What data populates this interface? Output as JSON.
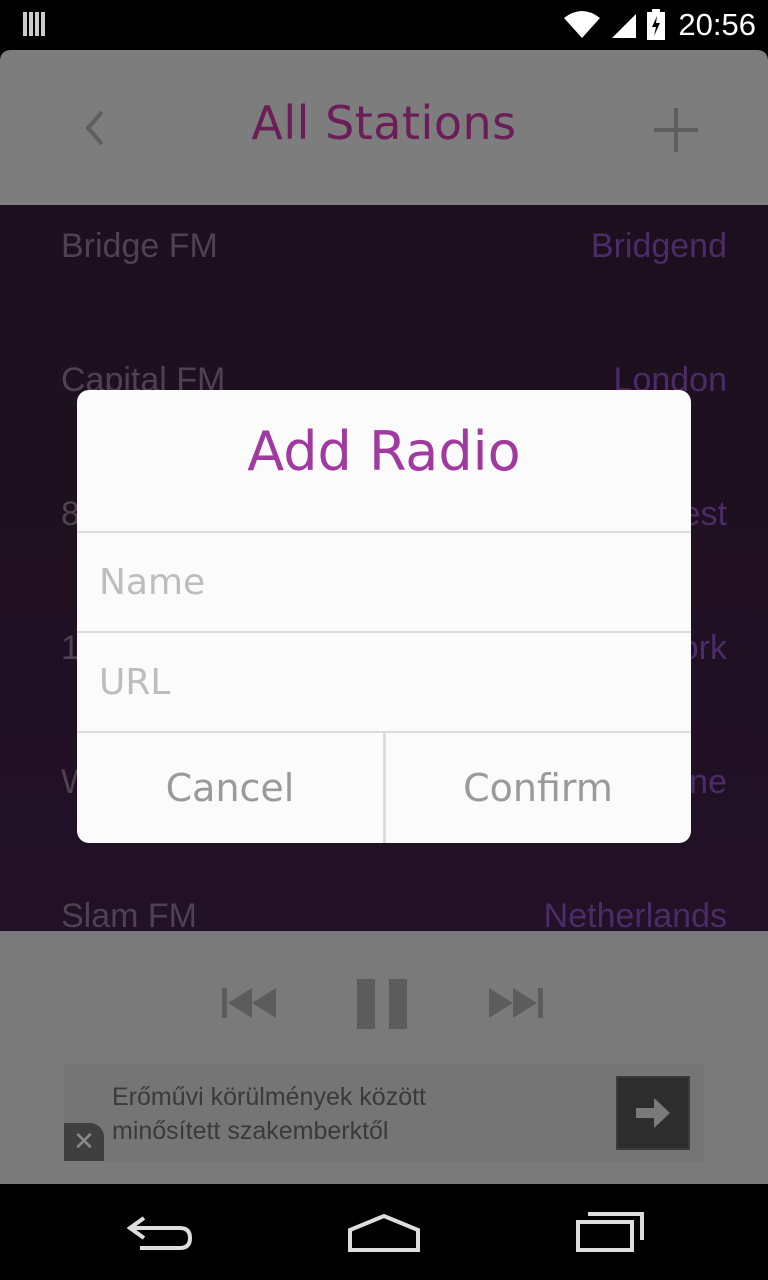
{
  "status_bar": {
    "time": "20:56"
  },
  "header": {
    "title": "All Stations"
  },
  "stations": [
    {
      "name": "Bridge FM",
      "location": "Bridgend"
    },
    {
      "name": "Capital FM",
      "location": "London"
    },
    {
      "name": "8",
      "location": "est"
    },
    {
      "name": "1",
      "location": "ork"
    },
    {
      "name": "W",
      "location": "ne"
    },
    {
      "name": "Slam FM",
      "location": "Netherlands"
    }
  ],
  "dialog": {
    "title": "Add Radio",
    "name_placeholder": "Name",
    "url_placeholder": "URL",
    "cancel_label": "Cancel",
    "confirm_label": "Confirm"
  },
  "ad": {
    "line1": "Erőművi körülmények között",
    "line2": "minősített szakemberktől",
    "close_label": "✕"
  },
  "colors": {
    "accent": "#a03aa0",
    "header_title": "#6a1d56",
    "dim_header": "#7d7d7d",
    "list_bg": "#1d0f1d"
  }
}
